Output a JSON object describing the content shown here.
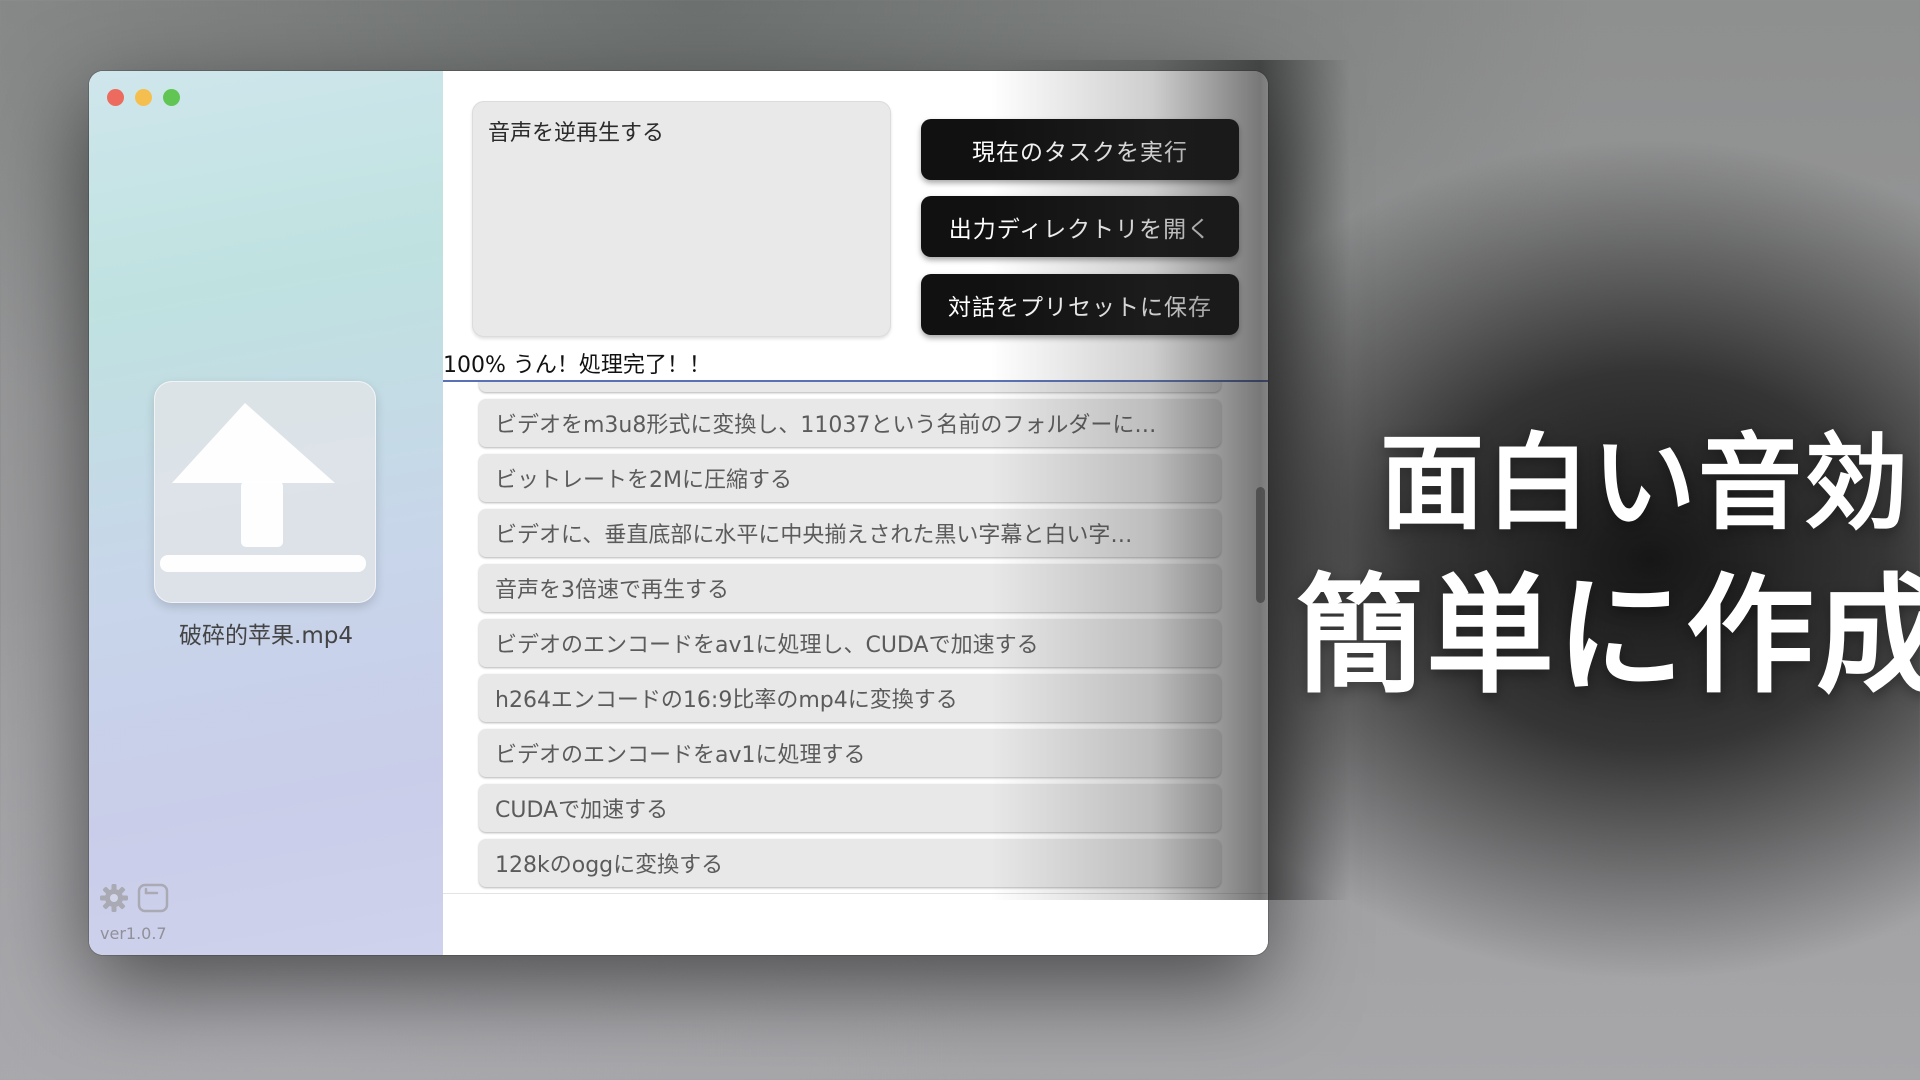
{
  "window": {
    "controls": [
      "close",
      "minimize",
      "maximize"
    ]
  },
  "sidebar": {
    "file_name": "破碎的苹果.mp4",
    "version": "ver1.0.7",
    "icons": [
      "gear-icon",
      "window-icon",
      "upload-icon"
    ]
  },
  "prompt": {
    "text": "音声を逆再生する"
  },
  "buttons": {
    "run": "現在のタスクを実行",
    "open_dir": "出力ディレクトリを開く",
    "save_preset": "対話をプリセットに保存"
  },
  "status": {
    "text": "100% うん！処理完了！！",
    "progress": 1.0
  },
  "presets": [
    "ビデオをm3u8形式に変換し、11037という名前のフォルダーに…",
    "ビットレートを2Mに圧縮する",
    "ビデオに、垂直底部に水平に中央揃えされた黒い字幕と白い字…",
    "音声を3倍速で再生する",
    "ビデオのエンコードをav1に処理し、CUDAで加速する",
    "h264エンコードの16:9比率のmp4に変換する",
    "ビデオのエンコードをav1に処理する",
    "CUDAで加速する",
    "128kのoggに変換する"
  ],
  "headline": {
    "line1": "面白い音効",
    "line2": "簡単に作成"
  },
  "colors": {
    "button_bg": "#111111",
    "progress_line": "#5a72b5",
    "close": "#ed6a5e",
    "minimize": "#f5bf4f",
    "maximize": "#61c554"
  }
}
